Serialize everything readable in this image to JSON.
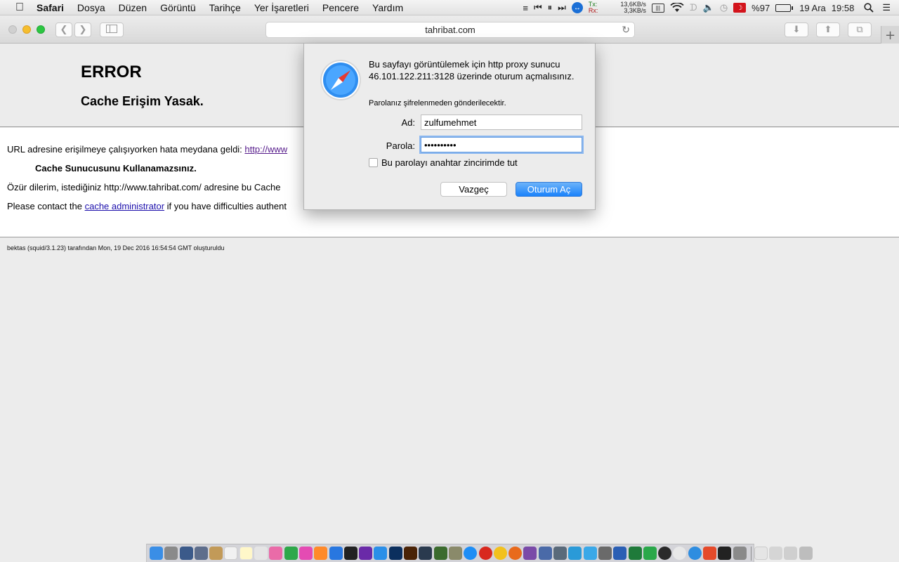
{
  "menubar": {
    "apple_icon": "apple-logo-icon",
    "items": [
      "Safari",
      "Dosya",
      "Düzen",
      "Görüntü",
      "Tarihçe",
      "Yer İşaretleri",
      "Pencere",
      "Yardım"
    ],
    "status": {
      "net_tx_label": "Tx:",
      "net_tx_value": "13,6KB/s",
      "net_rx_label": "Rx:",
      "net_rx_value": "3,3KB/s",
      "battery_percent": "%97",
      "date": "19 Ara",
      "time": "19:58"
    }
  },
  "toolbar": {
    "url": "tahribat.com"
  },
  "page": {
    "error_title": "ERROR",
    "error_subtitle": "Cache Erişim Yasak.",
    "line1_prefix": "URL adresine erişilmeye çalışıyorken hata meydana geldi:",
    "line1_link": "http://www",
    "line2_bold": "Cache Sunucusunu Kullanamazsınız.",
    "line3": "Özür dilerim, istediğiniz http://www.tahribat.com/ adresine bu Cache",
    "line4_prefix": "Please contact the",
    "line4_link": "cache administrator",
    "line4_suffix": "if you have difficulties authent",
    "footer": "bektas (squid/3.1.23) tarafından Mon, 19 Dec 2016 16:54:54 GMT oluşturuldu"
  },
  "dialog": {
    "message": "Bu sayfayı görüntülemek için http proxy sunucu 46.101.122.211:3128 üzerinde oturum açmalısınız.",
    "note": "Parolanız şifrelenmeden gönderilecektir.",
    "name_label": "Ad:",
    "name_value": "zulfumehmet",
    "password_label": "Parola:",
    "password_value": "••••••••••",
    "keychain_label": "Bu parolayı anahtar zincirimde tut",
    "keychain_checked": false,
    "cancel_label": "Vazgeç",
    "login_label": "Oturum Aç"
  },
  "colors": {
    "accent": "#1a82fb",
    "link": "#1a0dab"
  }
}
